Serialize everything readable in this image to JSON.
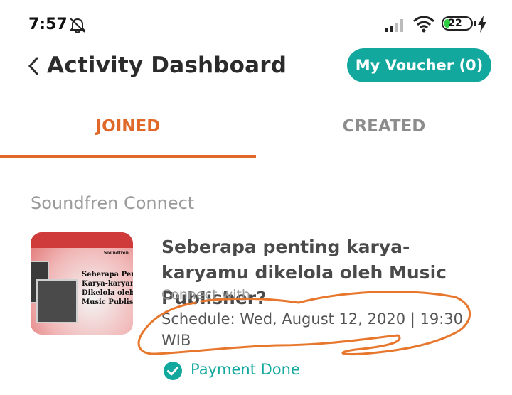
{
  "status_bar": {
    "time": "7:57",
    "battery_percent": "22",
    "battery_level": 0.22,
    "icons": [
      "bell-off-icon",
      "signal-icon",
      "wifi-icon",
      "battery-icon",
      "charging-bolt-icon"
    ]
  },
  "header": {
    "back_icon": "chevron-left-icon",
    "title": "Activity Dashboard",
    "voucher_label": "My Voucher (0)"
  },
  "tabs": [
    {
      "label": "JOINED",
      "active": true
    },
    {
      "label": "CREATED",
      "active": false
    }
  ],
  "section": {
    "label": "Soundfren Connect"
  },
  "event": {
    "title": "Seberapa penting karya-karyamu dikelola oleh Music Publisher?",
    "connect_with": "Connect with",
    "schedule": "Schedule: Wed, August 12, 2020 | 19:30 WIB",
    "status": "Payment Done",
    "status_icon": "check-circle-icon",
    "thumbnail_lines": [
      "Seberapa Pen",
      "Karya-karyan",
      "Dikelola oleh",
      "Music Publis"
    ],
    "thumbnail_brand": "Soundfren"
  },
  "colors": {
    "accent_orange": "#e0692a",
    "teal": "#13a89e",
    "annotation": "#e8772e"
  }
}
